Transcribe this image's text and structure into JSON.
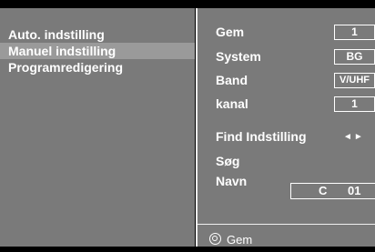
{
  "menu": {
    "items": [
      {
        "label": "Auto. indstilling",
        "selected": false
      },
      {
        "label": "Manuel indstilling",
        "selected": true
      },
      {
        "label": "Programredigering",
        "selected": false
      }
    ]
  },
  "settings": {
    "gem": {
      "label": "Gem",
      "value": "1"
    },
    "system": {
      "label": "System",
      "value": "BG"
    },
    "band": {
      "label": "Band",
      "value": "V/UHF"
    },
    "kanal": {
      "label": "kanal",
      "value": "1"
    },
    "find": {
      "label": "Find Indstilling",
      "arrows": "◄►"
    },
    "sog": {
      "label": "Søg"
    },
    "navn": {
      "label": "Navn",
      "channel_letter": "C",
      "channel_number": "01"
    }
  },
  "footer": {
    "icon": "ok-button-icon",
    "label": "Gem"
  },
  "colors": {
    "panel": "#7a7a7a",
    "selected": "#9a9a9a",
    "background": "#000000",
    "text": "#ffffff"
  }
}
